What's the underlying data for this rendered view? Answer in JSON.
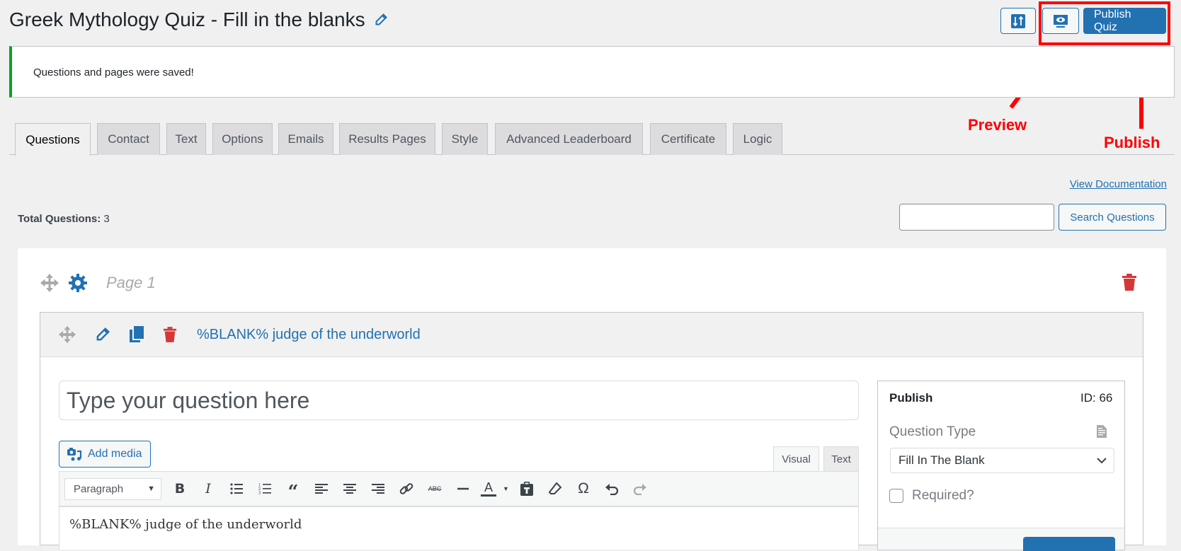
{
  "header": {
    "title": "Greek Mythology Quiz - Fill in the blanks",
    "edit_title_icon": "pencil-icon",
    "settings_button_icon": "sliders-icon",
    "preview_button_icon": "preview-monitor-eye-icon",
    "publish_button_label": "Publish Quiz"
  },
  "annotations": {
    "preview_label": "Preview",
    "publish_label": "Publish",
    "color": "#ff0000"
  },
  "notice": {
    "message": "Questions and pages were saved!",
    "color": "#00a32a"
  },
  "tabs": [
    {
      "label": "Questions",
      "active": true
    },
    {
      "label": "Contact",
      "active": false
    },
    {
      "label": "Text",
      "active": false
    },
    {
      "label": "Options",
      "active": false
    },
    {
      "label": "Emails",
      "active": false
    },
    {
      "label": "Results Pages",
      "active": false
    },
    {
      "label": "Style",
      "active": false
    },
    {
      "label": "Advanced Leaderboard",
      "active": false
    },
    {
      "label": "Certificate",
      "active": false
    },
    {
      "label": "Logic",
      "active": false
    }
  ],
  "toolbar_row": {
    "view_documentation": "View Documentation",
    "total_questions_label": "Total Questions:",
    "total_questions_value": "3",
    "search_input_value": "",
    "search_button_label": "Search Questions"
  },
  "page": {
    "name": "Page 1",
    "icons": [
      "move-icon",
      "gear-icon",
      "trash-icon"
    ]
  },
  "question": {
    "title": "%BLANK% judge of the underworld",
    "icons": [
      "move-icon",
      "pencil-icon",
      "duplicate-icon",
      "trash-icon"
    ],
    "question_placeholder": "Type your question here",
    "add_media_label": "Add media",
    "editor_tabs": {
      "visual": "Visual",
      "text": "Text",
      "active": "Visual"
    },
    "format_select_value": "Paragraph",
    "editor_toolbar": [
      "bold-icon",
      "italic-icon",
      "bullet-list-icon",
      "numbered-list-icon",
      "blockquote-icon",
      "align-left-icon",
      "align-center-icon",
      "align-right-icon",
      "link-icon",
      "strikethrough-icon",
      "horizontal-line-icon",
      "text-color-icon",
      "paste-text-icon",
      "clear-formatting-icon",
      "special-character-icon",
      "undo-icon",
      "redo-icon"
    ],
    "editor_content": "%BLANK% judge of the underworld"
  },
  "publish_panel": {
    "title": "Publish",
    "id_label": "ID: 66",
    "question_type_label": "Question Type",
    "question_type_value": "Fill In The Blank",
    "required_label": "Required?",
    "required_checked": false
  },
  "colors": {
    "accent": "#2271b1",
    "danger": "#d63638",
    "background": "#f0f0f1"
  }
}
